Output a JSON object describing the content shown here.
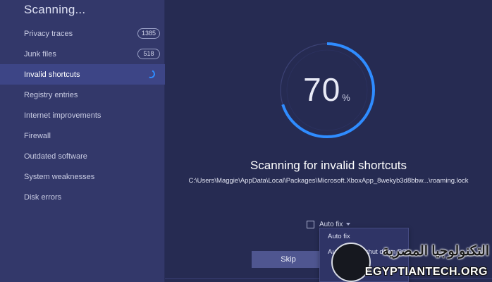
{
  "sidebar": {
    "title": "Scanning...",
    "items": [
      {
        "label": "Privacy traces",
        "badge": "1385"
      },
      {
        "label": "Junk files",
        "badge": "518"
      },
      {
        "label": "Invalid shortcuts",
        "status": "scanning"
      },
      {
        "label": "Registry entries"
      },
      {
        "label": "Internet improvements"
      },
      {
        "label": "Firewall"
      },
      {
        "label": "Outdated software"
      },
      {
        "label": "System weaknesses"
      },
      {
        "label": "Disk errors"
      }
    ]
  },
  "main": {
    "progress_value": "70",
    "progress_unit": "%",
    "progress_fraction": 0.7,
    "heading": "Scanning for invalid shortcuts",
    "current_path": "C:\\Users\\Maggie\\AppData\\Local\\Packages\\Microsoft.XboxApp_8wekyb3d8bbw...\\roaming.lock",
    "autofix_label": "Auto fix",
    "autofix_options": [
      "Auto fix",
      "Auto fix and shut down PC"
    ],
    "skip_label": "Skip"
  },
  "watermark": {
    "arabic": "التكنولوجيا المصرية",
    "latin": "EGYPTIANTECH.ORG"
  },
  "colors": {
    "background": "#262b52",
    "sidebar": "#33386a",
    "active_item": "#3d4586",
    "accent": "#2f8cff"
  }
}
